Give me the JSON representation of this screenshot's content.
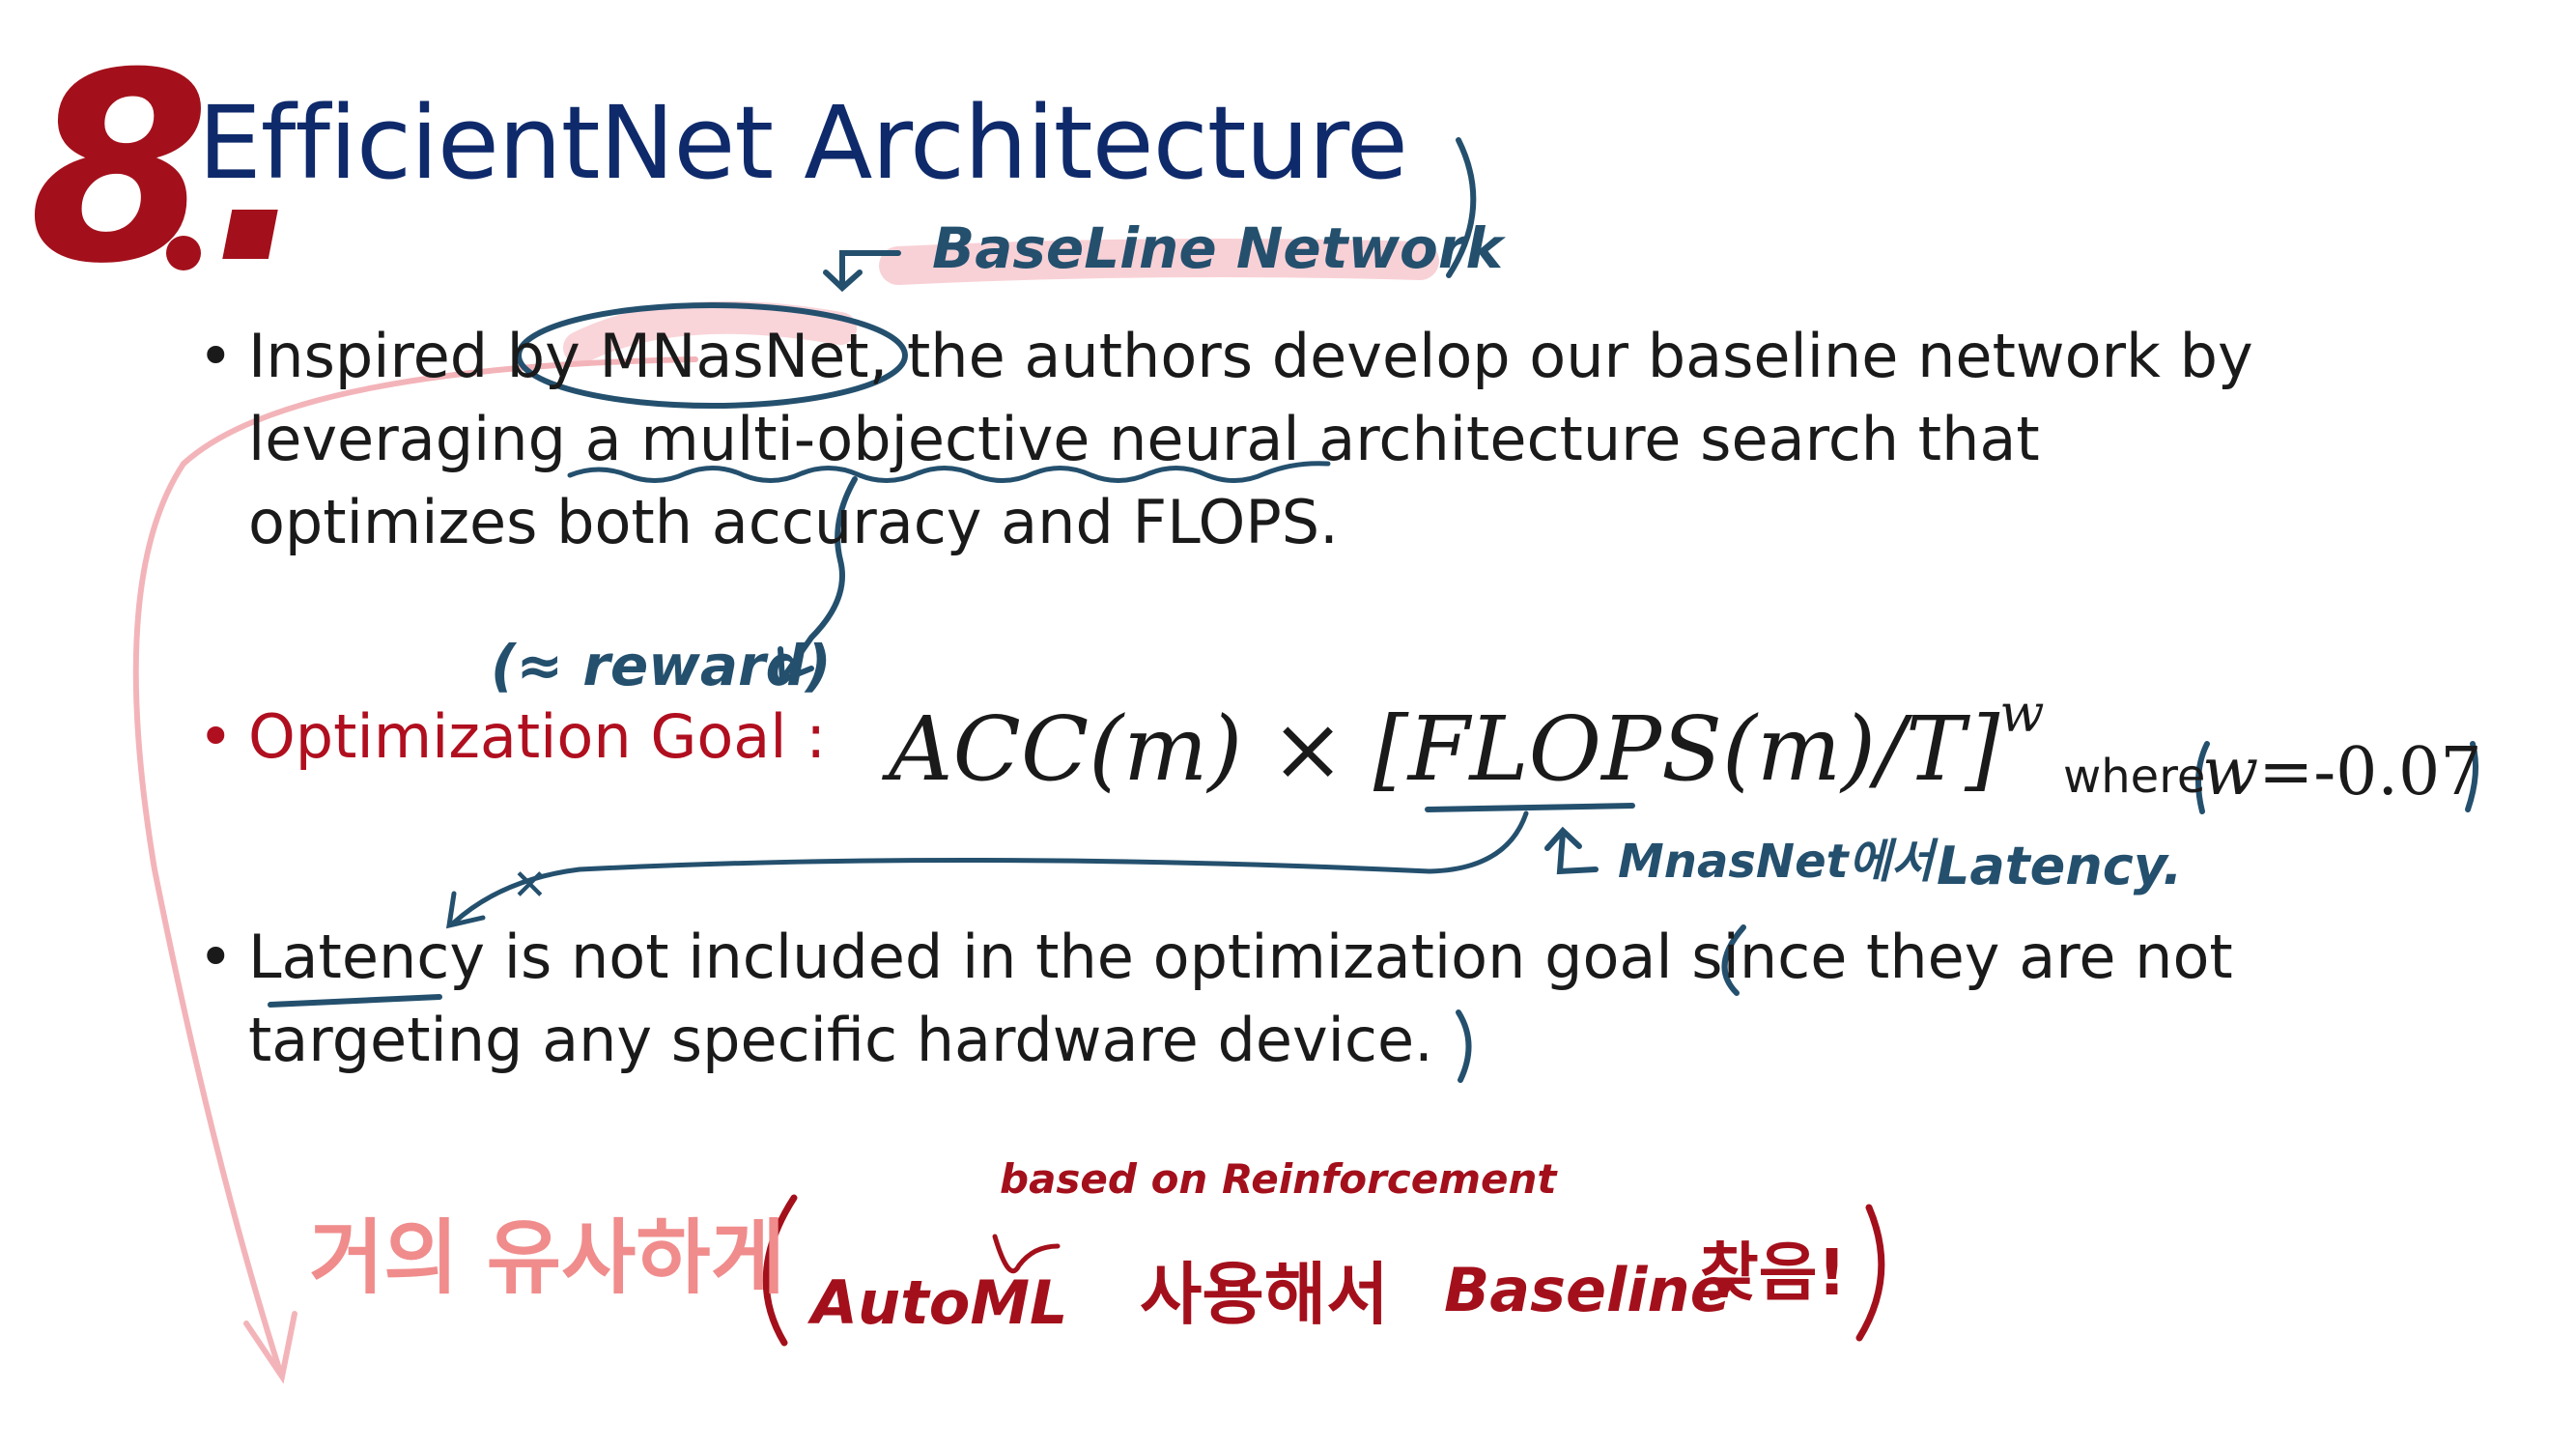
{
  "slide": {
    "number_label": "8.",
    "title": "EfficientNet Architecture",
    "bullets": [
      {
        "lines": [
          "Inspired by MNasNet, the authors develop our baseline network by",
          "leveraging a multi-objective neural architecture search that",
          "optimizes both accuracy and FLOPS."
        ]
      },
      {
        "label": "Optimization Goal :"
      },
      {
        "lines": [
          "Latency is not included in the optimization goal since they are not",
          "targeting any specific hardware device."
        ]
      }
    ],
    "bullet_symbol": "•",
    "formula": {
      "main": "ACC(m) × [FLOPS(m)/T]",
      "exponent": "w",
      "where_label": "where",
      "w_var": "w",
      "w_value": "=-0.07"
    }
  },
  "annotations": {
    "baseline_network": "BaseLine Network",
    "reward": "(≈ reward)",
    "mnasnet_latency_kr": "MnasNet에서",
    "latency": "Latency.",
    "x_mark": "✕",
    "similar_kr": "거의 유사하게",
    "based_on": "based on Reinforcement",
    "automl": "AutoML",
    "use_kr": "사용해서",
    "baseline": "Baseline",
    "find_kr": "찾음!",
    "open_paren": "(",
    "close_paren": ")"
  },
  "colors": {
    "title": "#0f2a6b",
    "body_text": "#1a1a1a",
    "goal_red": "#b00f1f",
    "ink_blue": "#24506e",
    "ink_red": "#a3101b",
    "ink_pink": "#f08c8c",
    "highlight_pink": "#f7c9cf"
  }
}
